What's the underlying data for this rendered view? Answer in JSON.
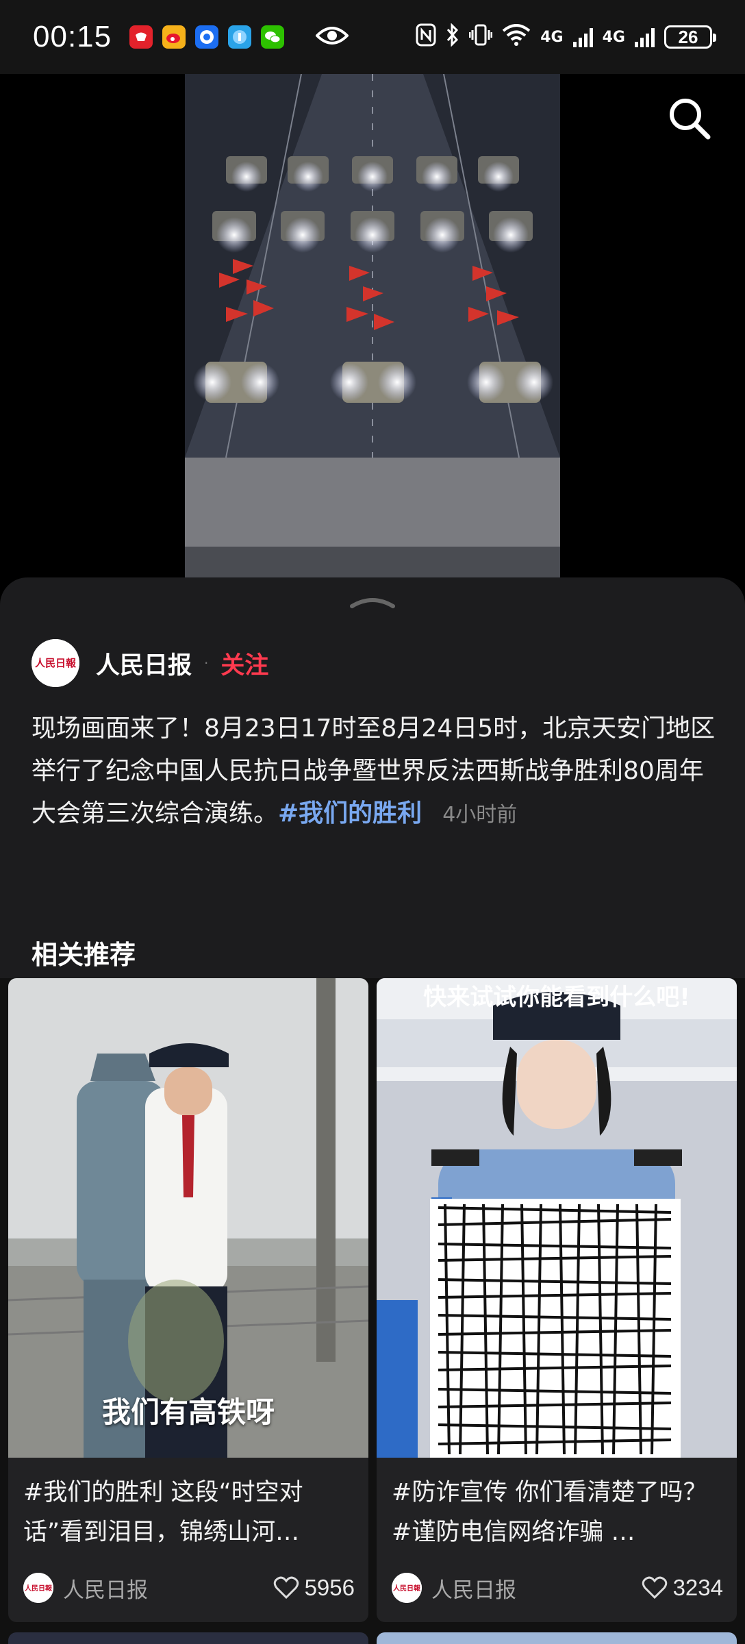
{
  "status_bar": {
    "time": "00:15",
    "network_1": "4G",
    "network_2": "4G",
    "battery": "26",
    "app_icons": [
      "huawei-app-icon",
      "weibo-icon",
      "browser-icon",
      "app-icon",
      "wechat-icon"
    ]
  },
  "post": {
    "author": "人民日报",
    "avatar_text": "人民日報",
    "separator": "·",
    "follow_label": "关注",
    "caption": "现场画面来了！8月23日17时至8月24日5时，北京天安门地区举行了纪念中国人民抗日战争暨世界反法西斯战争胜利80周年大会第三次综合演练。",
    "hashtag": "#我们的胜利",
    "time_ago": "4小时前"
  },
  "related": {
    "title": "相关推荐",
    "cards": [
      {
        "overlay_text": "我们有高铁呀",
        "title": "#我们的胜利  这段“时空对话”看到泪目，锦绣山河…",
        "author": "人民日报",
        "likes": "5956"
      },
      {
        "overlay_text": "快来试试你能看到什么吧!",
        "title": "#防诈宣传  你们看清楚了吗？#谨防电信网络诈骗 …",
        "author": "人民日报",
        "likes": "3234"
      }
    ]
  },
  "colors": {
    "follow": "#ff3a4f",
    "hashtag": "#79a8f0",
    "sheet_bg": "#1c1c1e"
  }
}
